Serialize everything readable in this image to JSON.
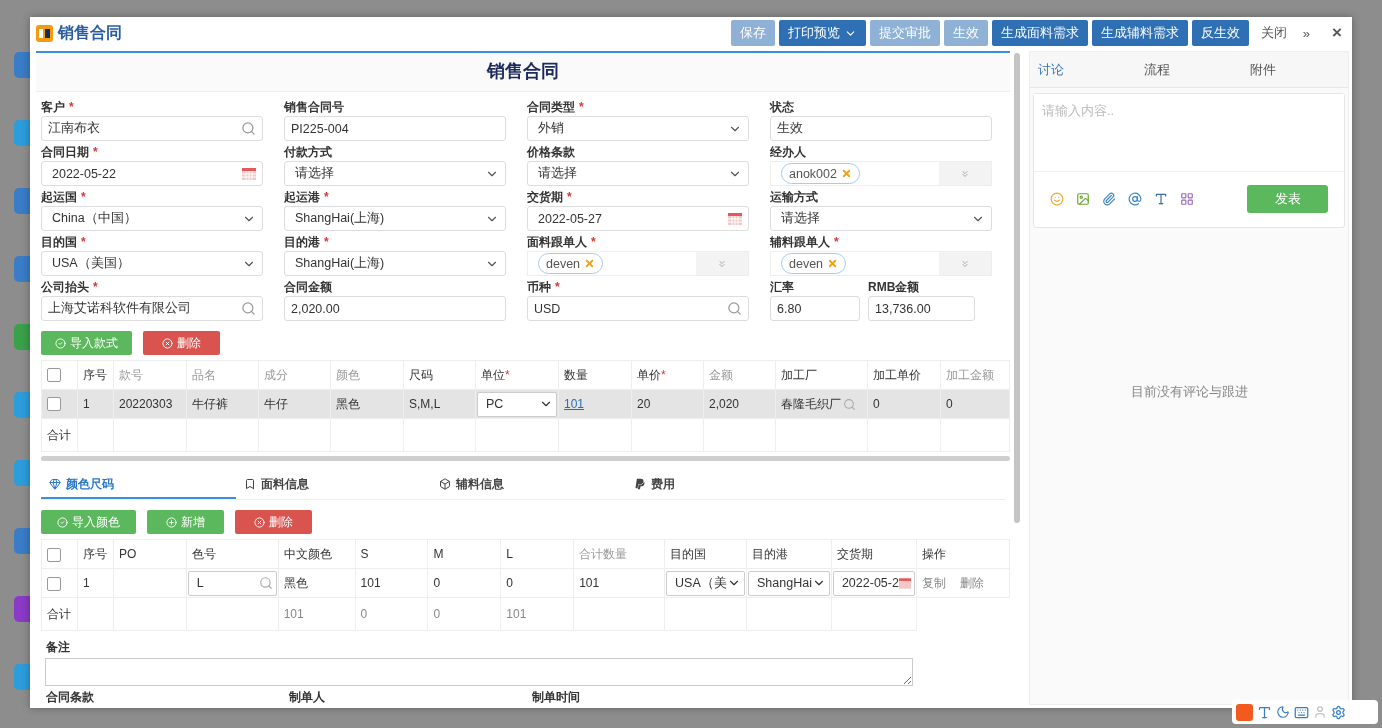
{
  "header": {
    "title": "销售合同",
    "buttons": [
      {
        "label": "保存",
        "disabled": true,
        "dropdown": false
      },
      {
        "label": "打印预览",
        "disabled": false,
        "dropdown": true
      },
      {
        "label": "提交审批",
        "disabled": true,
        "dropdown": false
      },
      {
        "label": "生效",
        "disabled": true,
        "dropdown": false
      },
      {
        "label": "生成面料需求",
        "disabled": false,
        "dropdown": false
      },
      {
        "label": "生成辅料需求",
        "disabled": false,
        "dropdown": false
      },
      {
        "label": "反生效",
        "disabled": false,
        "dropdown": false
      }
    ],
    "close_label": "关闭",
    "more": "»",
    "close": "×"
  },
  "required_mark": "*",
  "form": {
    "title": "销售合同",
    "fields": [
      {
        "label": "客户",
        "required": true,
        "kind": "search",
        "value": "江南布衣"
      },
      {
        "label": "销售合同号",
        "required": false,
        "kind": "text",
        "value": "PI225-004"
      },
      {
        "label": "合同类型",
        "required": true,
        "kind": "select",
        "value": "外销"
      },
      {
        "label": "状态",
        "required": false,
        "kind": "text",
        "value": "生效"
      },
      {
        "label": "合同日期",
        "required": true,
        "kind": "date",
        "value": "2022-05-22"
      },
      {
        "label": "付款方式",
        "required": false,
        "kind": "select",
        "value": "请选择"
      },
      {
        "label": "价格条款",
        "required": false,
        "kind": "select",
        "value": "请选择"
      },
      {
        "label": "经办人",
        "required": false,
        "kind": "tags",
        "tags": [
          "anok002"
        ]
      },
      {
        "label": "起运国",
        "required": true,
        "kind": "select",
        "value": "China（中国）"
      },
      {
        "label": "起运港",
        "required": true,
        "kind": "select",
        "value": "ShangHai(上海)"
      },
      {
        "label": "交货期",
        "required": true,
        "kind": "date",
        "value": "2022-05-27"
      },
      {
        "label": "运输方式",
        "required": false,
        "kind": "select",
        "value": "请选择"
      },
      {
        "label": "目的国",
        "required": true,
        "kind": "select",
        "value": "USA（美国）"
      },
      {
        "label": "目的港",
        "required": true,
        "kind": "select",
        "value": "ShangHai(上海)"
      },
      {
        "label": "面料跟单人",
        "required": true,
        "kind": "tags",
        "tags": [
          "deven"
        ]
      },
      {
        "label": "辅料跟单人",
        "required": true,
        "kind": "tags",
        "tags": [
          "deven"
        ]
      },
      {
        "label": "公司抬头",
        "required": true,
        "kind": "search",
        "value": "上海艾诺科软件有限公司"
      },
      {
        "label": "合同金额",
        "required": false,
        "kind": "text",
        "value": "2,020.00"
      },
      {
        "label": "币种",
        "required": true,
        "kind": "search",
        "value": "USD"
      },
      {
        "kind": "group",
        "fields": [
          {
            "label": "汇率",
            "required": false,
            "kind": "text",
            "value": "6.80"
          },
          {
            "label": "RMB金额",
            "required": false,
            "kind": "text",
            "value": "13,736.00"
          }
        ]
      }
    ]
  },
  "items": {
    "buttons": [
      {
        "label": "导入款式",
        "kind": "import"
      },
      {
        "label": "删除",
        "kind": "delete"
      }
    ],
    "all_checked": false,
    "columns": [
      {
        "label": "序号",
        "required": false,
        "readonly": false
      },
      {
        "label": "款号",
        "required": false,
        "readonly": true
      },
      {
        "label": "品名",
        "required": false,
        "readonly": true
      },
      {
        "label": "成分",
        "required": false,
        "readonly": true
      },
      {
        "label": "颜色",
        "required": false,
        "readonly": true
      },
      {
        "label": "尺码",
        "required": false,
        "readonly": false
      },
      {
        "label": "单位",
        "required": true,
        "readonly": false
      },
      {
        "label": "数量",
        "required": false,
        "readonly": false
      },
      {
        "label": "单价",
        "required": true,
        "readonly": false
      },
      {
        "label": "金额",
        "required": false,
        "readonly": true
      },
      {
        "label": "加工厂",
        "required": false,
        "readonly": false
      },
      {
        "label": "加工单价",
        "required": false,
        "readonly": false
      },
      {
        "label": "加工金额",
        "required": false,
        "readonly": true
      }
    ],
    "rows": [
      {
        "checked": false,
        "highlighted": true,
        "cells": [
          {
            "kind": "text",
            "text": "1"
          },
          {
            "kind": "text",
            "text": "20220303"
          },
          {
            "kind": "text",
            "text": "牛仔裤"
          },
          {
            "kind": "text",
            "text": "牛仔"
          },
          {
            "kind": "text",
            "text": "黑色"
          },
          {
            "kind": "text",
            "text": "S,M,L"
          },
          {
            "kind": "select",
            "text": "PC"
          },
          {
            "kind": "link",
            "text": "101"
          },
          {
            "kind": "text",
            "text": "20"
          },
          {
            "kind": "text",
            "text": "2,020"
          },
          {
            "kind": "lookup",
            "text": "春隆毛织厂"
          },
          {
            "kind": "text",
            "text": "0"
          },
          {
            "kind": "text",
            "text": "0"
          }
        ]
      }
    ],
    "total_label": "合计"
  },
  "tabs": [
    {
      "label": "颜色尺码",
      "selected": true
    },
    {
      "label": "面料信息",
      "selected": false
    },
    {
      "label": "辅料信息",
      "selected": false
    },
    {
      "label": "费用",
      "selected": false
    }
  ],
  "colors": {
    "buttons": [
      {
        "label": "导入颜色",
        "kind": "import"
      },
      {
        "label": "新增",
        "kind": "add"
      },
      {
        "label": "删除",
        "kind": "delete"
      }
    ],
    "all_checked": false,
    "columns": [
      {
        "label": "序号",
        "readonly": false
      },
      {
        "label": "PO",
        "readonly": false
      },
      {
        "label": "色号",
        "readonly": false
      },
      {
        "label": "中文颜色",
        "readonly": false
      },
      {
        "label": "S",
        "readonly": false
      },
      {
        "label": "M",
        "readonly": false
      },
      {
        "label": "L",
        "readonly": false
      },
      {
        "label": "合计数量",
        "readonly": true
      },
      {
        "label": "目的国",
        "readonly": false
      },
      {
        "label": "目的港",
        "readonly": false
      },
      {
        "label": "交货期",
        "readonly": false
      },
      {
        "label": "操作",
        "readonly": false
      }
    ],
    "rows": [
      {
        "checked": false,
        "cells": [
          {
            "kind": "text",
            "text": "1"
          },
          {
            "kind": "empty"
          },
          {
            "kind": "search",
            "text": "L"
          },
          {
            "kind": "text",
            "text": "黑色"
          },
          {
            "kind": "text",
            "text": "101"
          },
          {
            "kind": "text",
            "text": "0"
          },
          {
            "kind": "text",
            "text": "0"
          },
          {
            "kind": "text",
            "text": "101"
          },
          {
            "kind": "select",
            "text": "USA（美"
          },
          {
            "kind": "select",
            "text": "ShangHai"
          },
          {
            "kind": "date",
            "text": "2022-05-2"
          },
          {
            "kind": "actions",
            "actions": [
              "复制",
              "删除"
            ]
          }
        ]
      }
    ],
    "total": {
      "label": "合计",
      "cells": [
        {
          "kind": "empty"
        },
        {
          "kind": "empty"
        },
        {
          "kind": "empty"
        },
        {
          "kind": "muted",
          "text": "101"
        },
        {
          "kind": "muted",
          "text": "0"
        },
        {
          "kind": "muted",
          "text": "0"
        },
        {
          "kind": "muted",
          "text": "101"
        },
        {
          "kind": "empty"
        },
        {
          "kind": "empty"
        },
        {
          "kind": "empty"
        },
        {
          "kind": "empty"
        }
      ]
    }
  },
  "remarks": {
    "label": "备注"
  },
  "footer_labels": [
    "合同条款",
    "制单人",
    "制单时间"
  ],
  "side": {
    "tabs": [
      {
        "label": "讨论",
        "selected": true
      },
      {
        "label": "流程",
        "selected": false
      },
      {
        "label": "附件",
        "selected": false
      }
    ],
    "placeholder": "请输入内容..",
    "submit": "发表",
    "empty_message": "目前没有评论与跟进"
  }
}
